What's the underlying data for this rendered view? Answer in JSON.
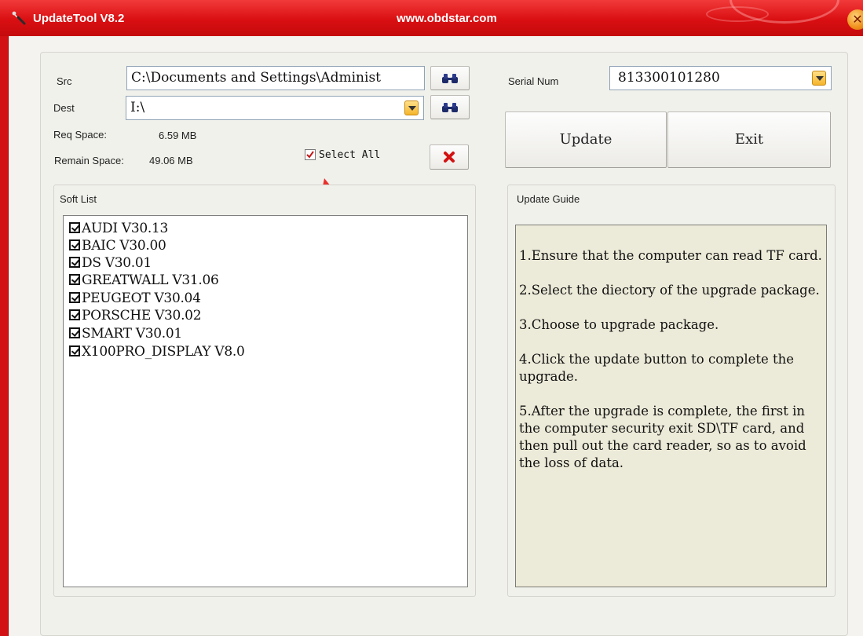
{
  "window": {
    "title": "UpdateTool V8.2",
    "url": "www.obdstar.com",
    "accent_color": "#d90f12",
    "close_icon": "close-icon"
  },
  "src": {
    "label": "Src",
    "value": "C:\\Documents and Settings\\Administ"
  },
  "dest": {
    "label": "Dest",
    "value": "I:\\"
  },
  "req_space": {
    "label": "Req Space:",
    "value": "6.59 MB"
  },
  "remain_space": {
    "label": "Remain Space:",
    "value": "49.06 MB"
  },
  "select_all": {
    "label": "Select All",
    "checked": true
  },
  "serial": {
    "label": "Serial Num",
    "value": "813300101280"
  },
  "buttons": {
    "update": "Update",
    "exit": "Exit"
  },
  "soft_list": {
    "title": "Soft List",
    "items": [
      "AUDI V30.13",
      "BAIC V30.00",
      "DS V30.01",
      "GREATWALL V31.06",
      "PEUGEOT V30.04",
      "PORSCHE V30.02",
      "SMART V30.01",
      "X100PRO_DISPLAY V8.0"
    ]
  },
  "update_guide": {
    "title": "Update Guide",
    "steps": [
      "1.Ensure that the computer can read TF card.",
      "2.Select the diectory of the upgrade package.",
      "3.Choose to upgrade package.",
      "4.Click the update button to complete the upgrade.",
      "5.After the upgrade is complete, the first in the computer security exit SD\\TF card, and then pull out the card reader, so as to avoid the loss of data."
    ]
  }
}
